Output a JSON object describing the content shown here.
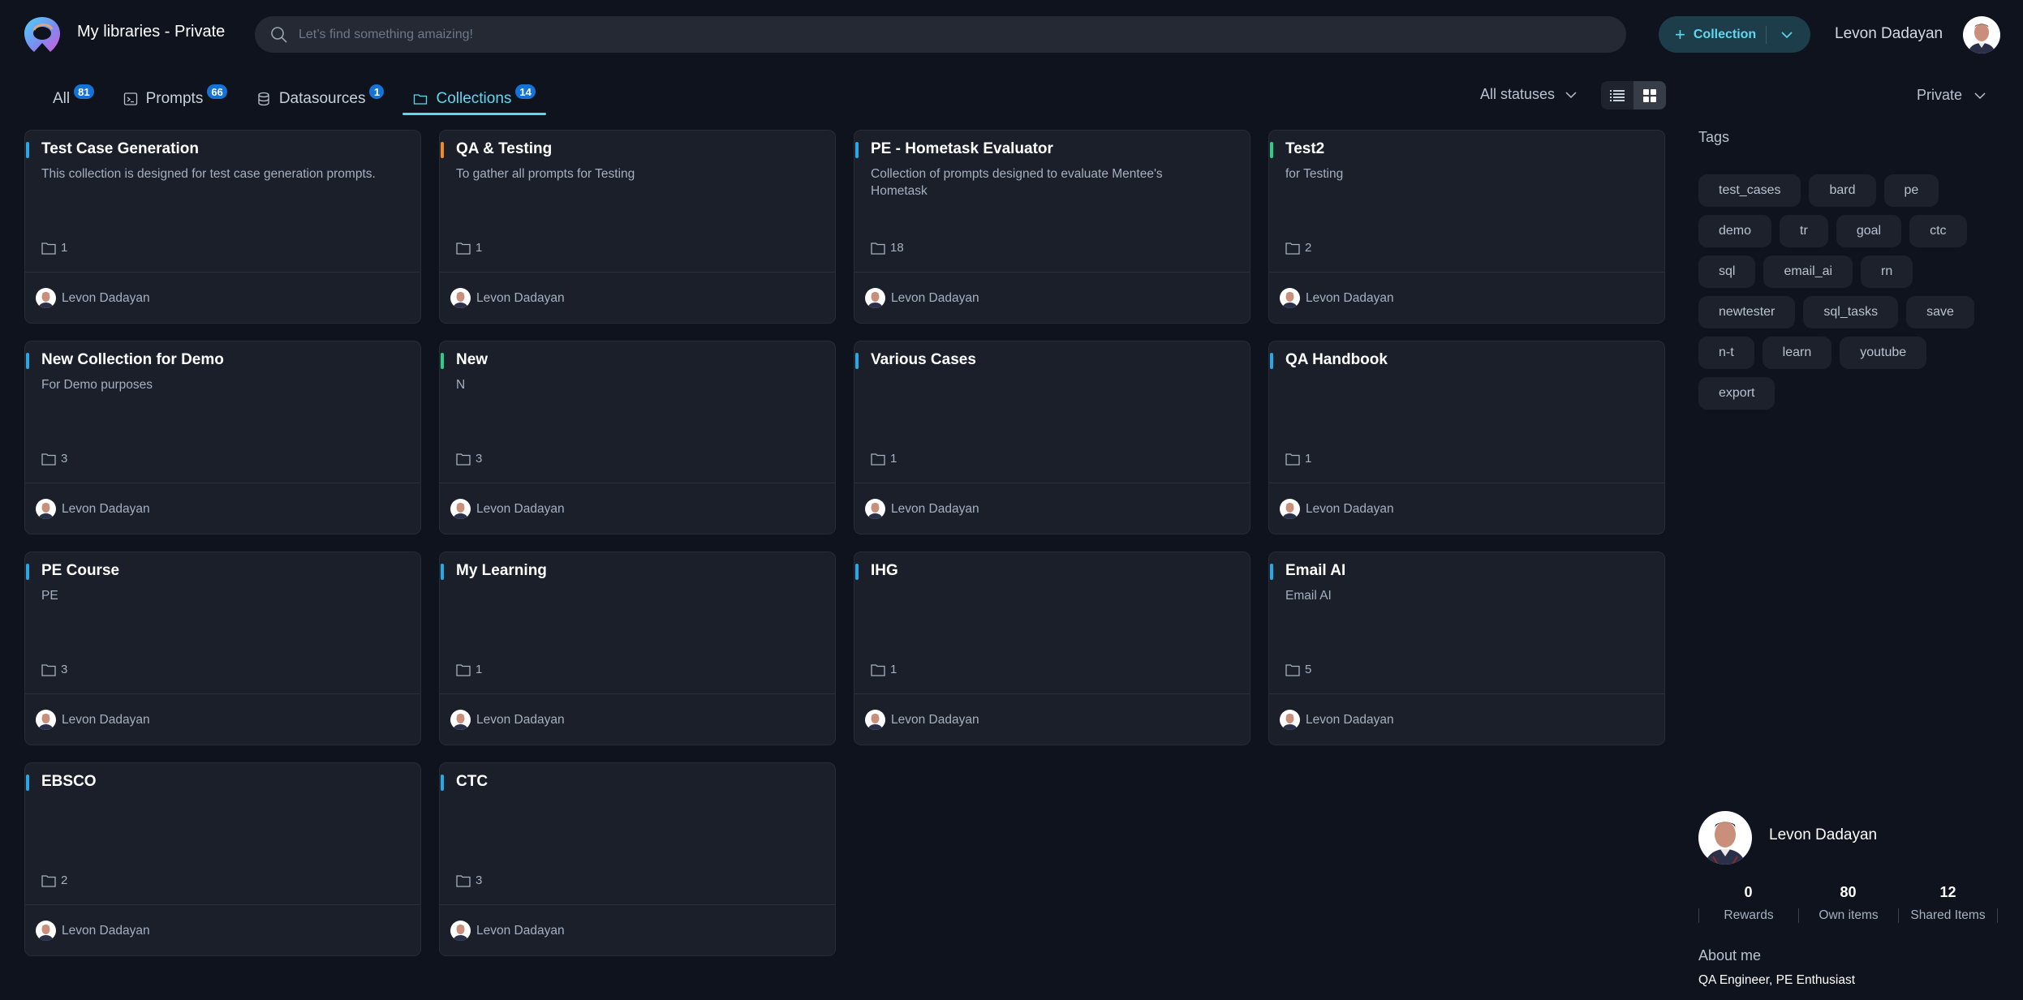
{
  "header": {
    "title": "My libraries - Private",
    "search_placeholder": "Let’s find something amaizing!",
    "add_button_label": "Collection",
    "user_name": "Levon Dadayan"
  },
  "tabs": [
    {
      "label": "All",
      "count": "81",
      "icon": "none",
      "active": false
    },
    {
      "label": "Prompts",
      "count": "66",
      "icon": "terminal-icon",
      "active": false
    },
    {
      "label": "Datasources",
      "count": "1",
      "icon": "database-icon",
      "active": false
    },
    {
      "label": "Collections",
      "count": "14",
      "icon": "folder-icon",
      "active": true
    }
  ],
  "filters": {
    "status": "All statuses",
    "visibility": "Private",
    "view_mode": "grid"
  },
  "accent_colors": {
    "blue": "#29a8e6",
    "orange": "#f08a24",
    "green": "#2ecc88"
  },
  "collections": [
    {
      "title": "Test Case Generation",
      "description": "This collection is designed for test case generation prompts.",
      "count": "1",
      "owner": "Levon Dadayan",
      "accent": "#29a8e6"
    },
    {
      "title": "QA & Testing",
      "description": "To gather all prompts for Testing",
      "count": "1",
      "owner": "Levon Dadayan",
      "accent": "#f08a24"
    },
    {
      "title": "PE - Hometask Evaluator",
      "description": "Collection of prompts designed to evaluate Mentee's Hometask",
      "count": "18",
      "owner": "Levon Dadayan",
      "accent": "#29a8e6"
    },
    {
      "title": "Test2",
      "description": "for Testing",
      "count": "2",
      "owner": "Levon Dadayan",
      "accent": "#2ecc88"
    },
    {
      "title": "New Collection for Demo",
      "description": "For Demo purposes",
      "count": "3",
      "owner": "Levon Dadayan",
      "accent": "#29a8e6"
    },
    {
      "title": "New",
      "description": "N",
      "count": "3",
      "owner": "Levon Dadayan",
      "accent": "#2ecc88"
    },
    {
      "title": "Various Cases",
      "description": "",
      "count": "1",
      "owner": "Levon Dadayan",
      "accent": "#29a8e6"
    },
    {
      "title": "QA Handbook",
      "description": "",
      "count": "1",
      "owner": "Levon Dadayan",
      "accent": "#29a8e6"
    },
    {
      "title": "PE Course",
      "description": "PE",
      "count": "3",
      "owner": "Levon Dadayan",
      "accent": "#29a8e6"
    },
    {
      "title": "My Learning",
      "description": "",
      "count": "1",
      "owner": "Levon Dadayan",
      "accent": "#29a8e6"
    },
    {
      "title": "IHG",
      "description": "",
      "count": "1",
      "owner": "Levon Dadayan",
      "accent": "#29a8e6"
    },
    {
      "title": "Email AI",
      "description": "Email AI",
      "count": "5",
      "owner": "Levon Dadayan",
      "accent": "#29a8e6"
    },
    {
      "title": "EBSCO",
      "description": "",
      "count": "2",
      "owner": "Levon Dadayan",
      "accent": "#29a8e6"
    },
    {
      "title": "CTC",
      "description": "",
      "count": "3",
      "owner": "Levon Dadayan",
      "accent": "#29a8e6"
    }
  ],
  "sidebar": {
    "tags_title": "Tags",
    "tags": [
      "test_cases",
      "bard",
      "pe",
      "demo",
      "tr",
      "goal",
      "ctc",
      "sql",
      "email_ai",
      "rn",
      "newtester",
      "sql_tasks",
      "save",
      "n-t",
      "learn",
      "youtube",
      "export"
    ],
    "profile": {
      "name": "Levon Dadayan",
      "stats": [
        {
          "value": "0",
          "label": "Rewards"
        },
        {
          "value": "80",
          "label": "Own items"
        },
        {
          "value": "12",
          "label": "Shared Items"
        }
      ],
      "about_title": "About me",
      "about_text": "QA Engineer, PE Enthusiast"
    }
  }
}
